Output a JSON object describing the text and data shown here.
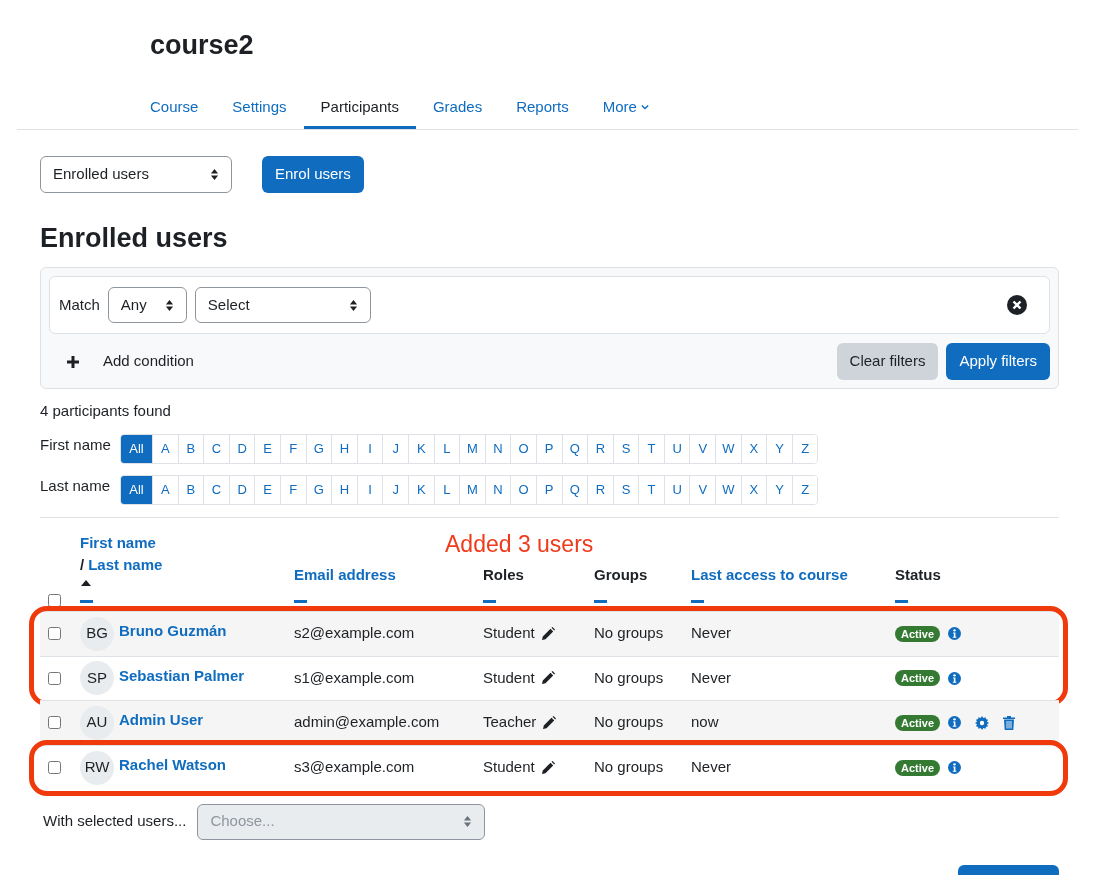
{
  "course_title": "course2",
  "tabs": [
    {
      "label": "Course",
      "selected": false
    },
    {
      "label": "Settings",
      "selected": false
    },
    {
      "label": "Participants",
      "selected": true
    },
    {
      "label": "Grades",
      "selected": false
    },
    {
      "label": "Reports",
      "selected": false
    },
    {
      "label": "More",
      "selected": false,
      "dropdown": true
    }
  ],
  "view_select": {
    "value": "Enrolled users"
  },
  "enrol_button": "Enrol users",
  "heading": "Enrolled users",
  "filter": {
    "match_label": "Match",
    "match_value": "Any",
    "condition_value": "Select",
    "add_condition": "Add condition",
    "clear_button": "Clear filters",
    "apply_button": "Apply filters"
  },
  "count_text": "4 participants found",
  "initials_bars": [
    {
      "label": "First name",
      "letters": [
        {
          "text": "All",
          "selected": true
        },
        {
          "text": "A",
          "selected": false
        },
        {
          "text": "B",
          "selected": false
        },
        {
          "text": "C",
          "selected": false
        },
        {
          "text": "D",
          "selected": false
        },
        {
          "text": "E",
          "selected": false
        },
        {
          "text": "F",
          "selected": false
        },
        {
          "text": "G",
          "selected": false
        },
        {
          "text": "H",
          "selected": false
        },
        {
          "text": "I",
          "selected": false
        },
        {
          "text": "J",
          "selected": false
        },
        {
          "text": "K",
          "selected": false
        },
        {
          "text": "L",
          "selected": false
        },
        {
          "text": "M",
          "selected": false
        },
        {
          "text": "N",
          "selected": false
        },
        {
          "text": "O",
          "selected": false
        },
        {
          "text": "P",
          "selected": false
        },
        {
          "text": "Q",
          "selected": false
        },
        {
          "text": "R",
          "selected": false
        },
        {
          "text": "S",
          "selected": false
        },
        {
          "text": "T",
          "selected": false
        },
        {
          "text": "U",
          "selected": false
        },
        {
          "text": "V",
          "selected": false
        },
        {
          "text": "W",
          "selected": false
        },
        {
          "text": "X",
          "selected": false
        },
        {
          "text": "Y",
          "selected": false
        },
        {
          "text": "Z",
          "selected": false
        }
      ]
    },
    {
      "label": "Last name",
      "letters": [
        {
          "text": "All",
          "selected": true
        },
        {
          "text": "A",
          "selected": false
        },
        {
          "text": "B",
          "selected": false
        },
        {
          "text": "C",
          "selected": false
        },
        {
          "text": "D",
          "selected": false
        },
        {
          "text": "E",
          "selected": false
        },
        {
          "text": "F",
          "selected": false
        },
        {
          "text": "G",
          "selected": false
        },
        {
          "text": "H",
          "selected": false
        },
        {
          "text": "I",
          "selected": false
        },
        {
          "text": "J",
          "selected": false
        },
        {
          "text": "K",
          "selected": false
        },
        {
          "text": "L",
          "selected": false
        },
        {
          "text": "M",
          "selected": false
        },
        {
          "text": "N",
          "selected": false
        },
        {
          "text": "O",
          "selected": false
        },
        {
          "text": "P",
          "selected": false
        },
        {
          "text": "Q",
          "selected": false
        },
        {
          "text": "R",
          "selected": false
        },
        {
          "text": "S",
          "selected": false
        },
        {
          "text": "T",
          "selected": false
        },
        {
          "text": "U",
          "selected": false
        },
        {
          "text": "V",
          "selected": false
        },
        {
          "text": "W",
          "selected": false
        },
        {
          "text": "X",
          "selected": false
        },
        {
          "text": "Y",
          "selected": false
        },
        {
          "text": "Z",
          "selected": false
        }
      ]
    }
  ],
  "annotation": "Added 3 users",
  "table": {
    "select_all_checked": false,
    "columns": [
      {
        "label": "First name",
        "separator": "/",
        "label2": "Last name",
        "sortable": true,
        "sorted": true
      },
      {
        "label": "Email address",
        "sortable": true,
        "sorted": false
      },
      {
        "label": "Roles",
        "sortable": false,
        "sorted": false
      },
      {
        "label": "Groups",
        "sortable": false,
        "sorted": false
      },
      {
        "label": "Last access to course",
        "sortable": true,
        "sorted": false
      },
      {
        "label": "Status",
        "sortable": false,
        "sorted": false
      }
    ],
    "row_groups": [
      {
        "highlighted": true,
        "rows": [
          {
            "checked": false,
            "initials": "BG",
            "name": "Bruno Guzmán",
            "email": "s2@example.com",
            "role": "Student",
            "groups": "No groups",
            "last_access": "Never",
            "status": "Active",
            "actions": [
              {
                "kind": "info"
              }
            ]
          },
          {
            "checked": false,
            "initials": "SP",
            "name": "Sebastian Palmer",
            "email": "s1@example.com",
            "role": "Student",
            "groups": "No groups",
            "last_access": "Never",
            "status": "Active",
            "actions": [
              {
                "kind": "info"
              }
            ]
          }
        ]
      },
      {
        "highlighted": false,
        "rows": [
          {
            "checked": false,
            "initials": "AU",
            "name": "Admin User",
            "email": "admin@example.com",
            "role": "Teacher",
            "groups": "No groups",
            "last_access": "now",
            "status": "Active",
            "actions": [
              {
                "kind": "info"
              },
              {
                "kind": "settings"
              },
              {
                "kind": "delete"
              }
            ]
          }
        ]
      },
      {
        "highlighted": true,
        "rows": [
          {
            "checked": false,
            "initials": "RW",
            "name": "Rachel Watson",
            "email": "s3@example.com",
            "role": "Student",
            "groups": "No groups",
            "last_access": "Never",
            "status": "Active",
            "actions": [
              {
                "kind": "info"
              }
            ]
          }
        ]
      }
    ]
  },
  "bulk": {
    "label": "With selected users...",
    "placeholder": "Choose...",
    "disabled": true
  }
}
